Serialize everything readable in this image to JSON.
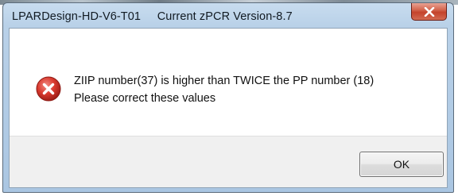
{
  "window": {
    "title": "LPARDesign-HD-V6-T01     Current zPCR Version-8.7"
  },
  "titlebar": {
    "close_icon": "close-x-icon"
  },
  "message": {
    "icon": "error-icon",
    "line1": "ZIIP number(37) is higher than TWICE the PP number (18)",
    "line2": "Please correct these values"
  },
  "buttons": {
    "ok_label": "OK"
  },
  "colors": {
    "error_red": "#c9302c",
    "close_button_red": "#c4432b",
    "titlebar_blue": "#b9d1e8"
  }
}
